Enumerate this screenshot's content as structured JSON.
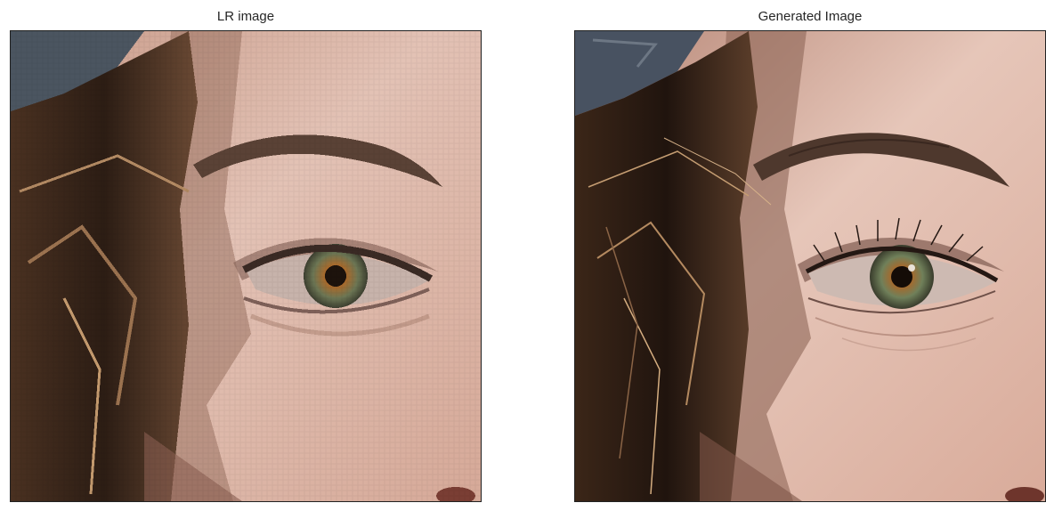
{
  "figure": {
    "panels": [
      {
        "title": "LR image",
        "image_description": "low-resolution, pixelated close-up of a woman's right eye with brown hair strands on the left"
      },
      {
        "title": "Generated Image",
        "image_description": "sharp super-resolved close-up of the same eye with detailed lashes, eyebrow and skin texture"
      }
    ]
  },
  "colors": {
    "background": "#ffffff",
    "title_text": "#262626",
    "frame_border": "#222222",
    "skin_light": "#e8c9bd",
    "skin_mid": "#d4a796",
    "skin_shadow": "#8a6456",
    "hair_dark": "#2a1d16",
    "hair_highlight": "#a9825a",
    "iris": "#6f7a52",
    "iris_ring": "#a0652a",
    "hat_grey": "#4b5560"
  }
}
